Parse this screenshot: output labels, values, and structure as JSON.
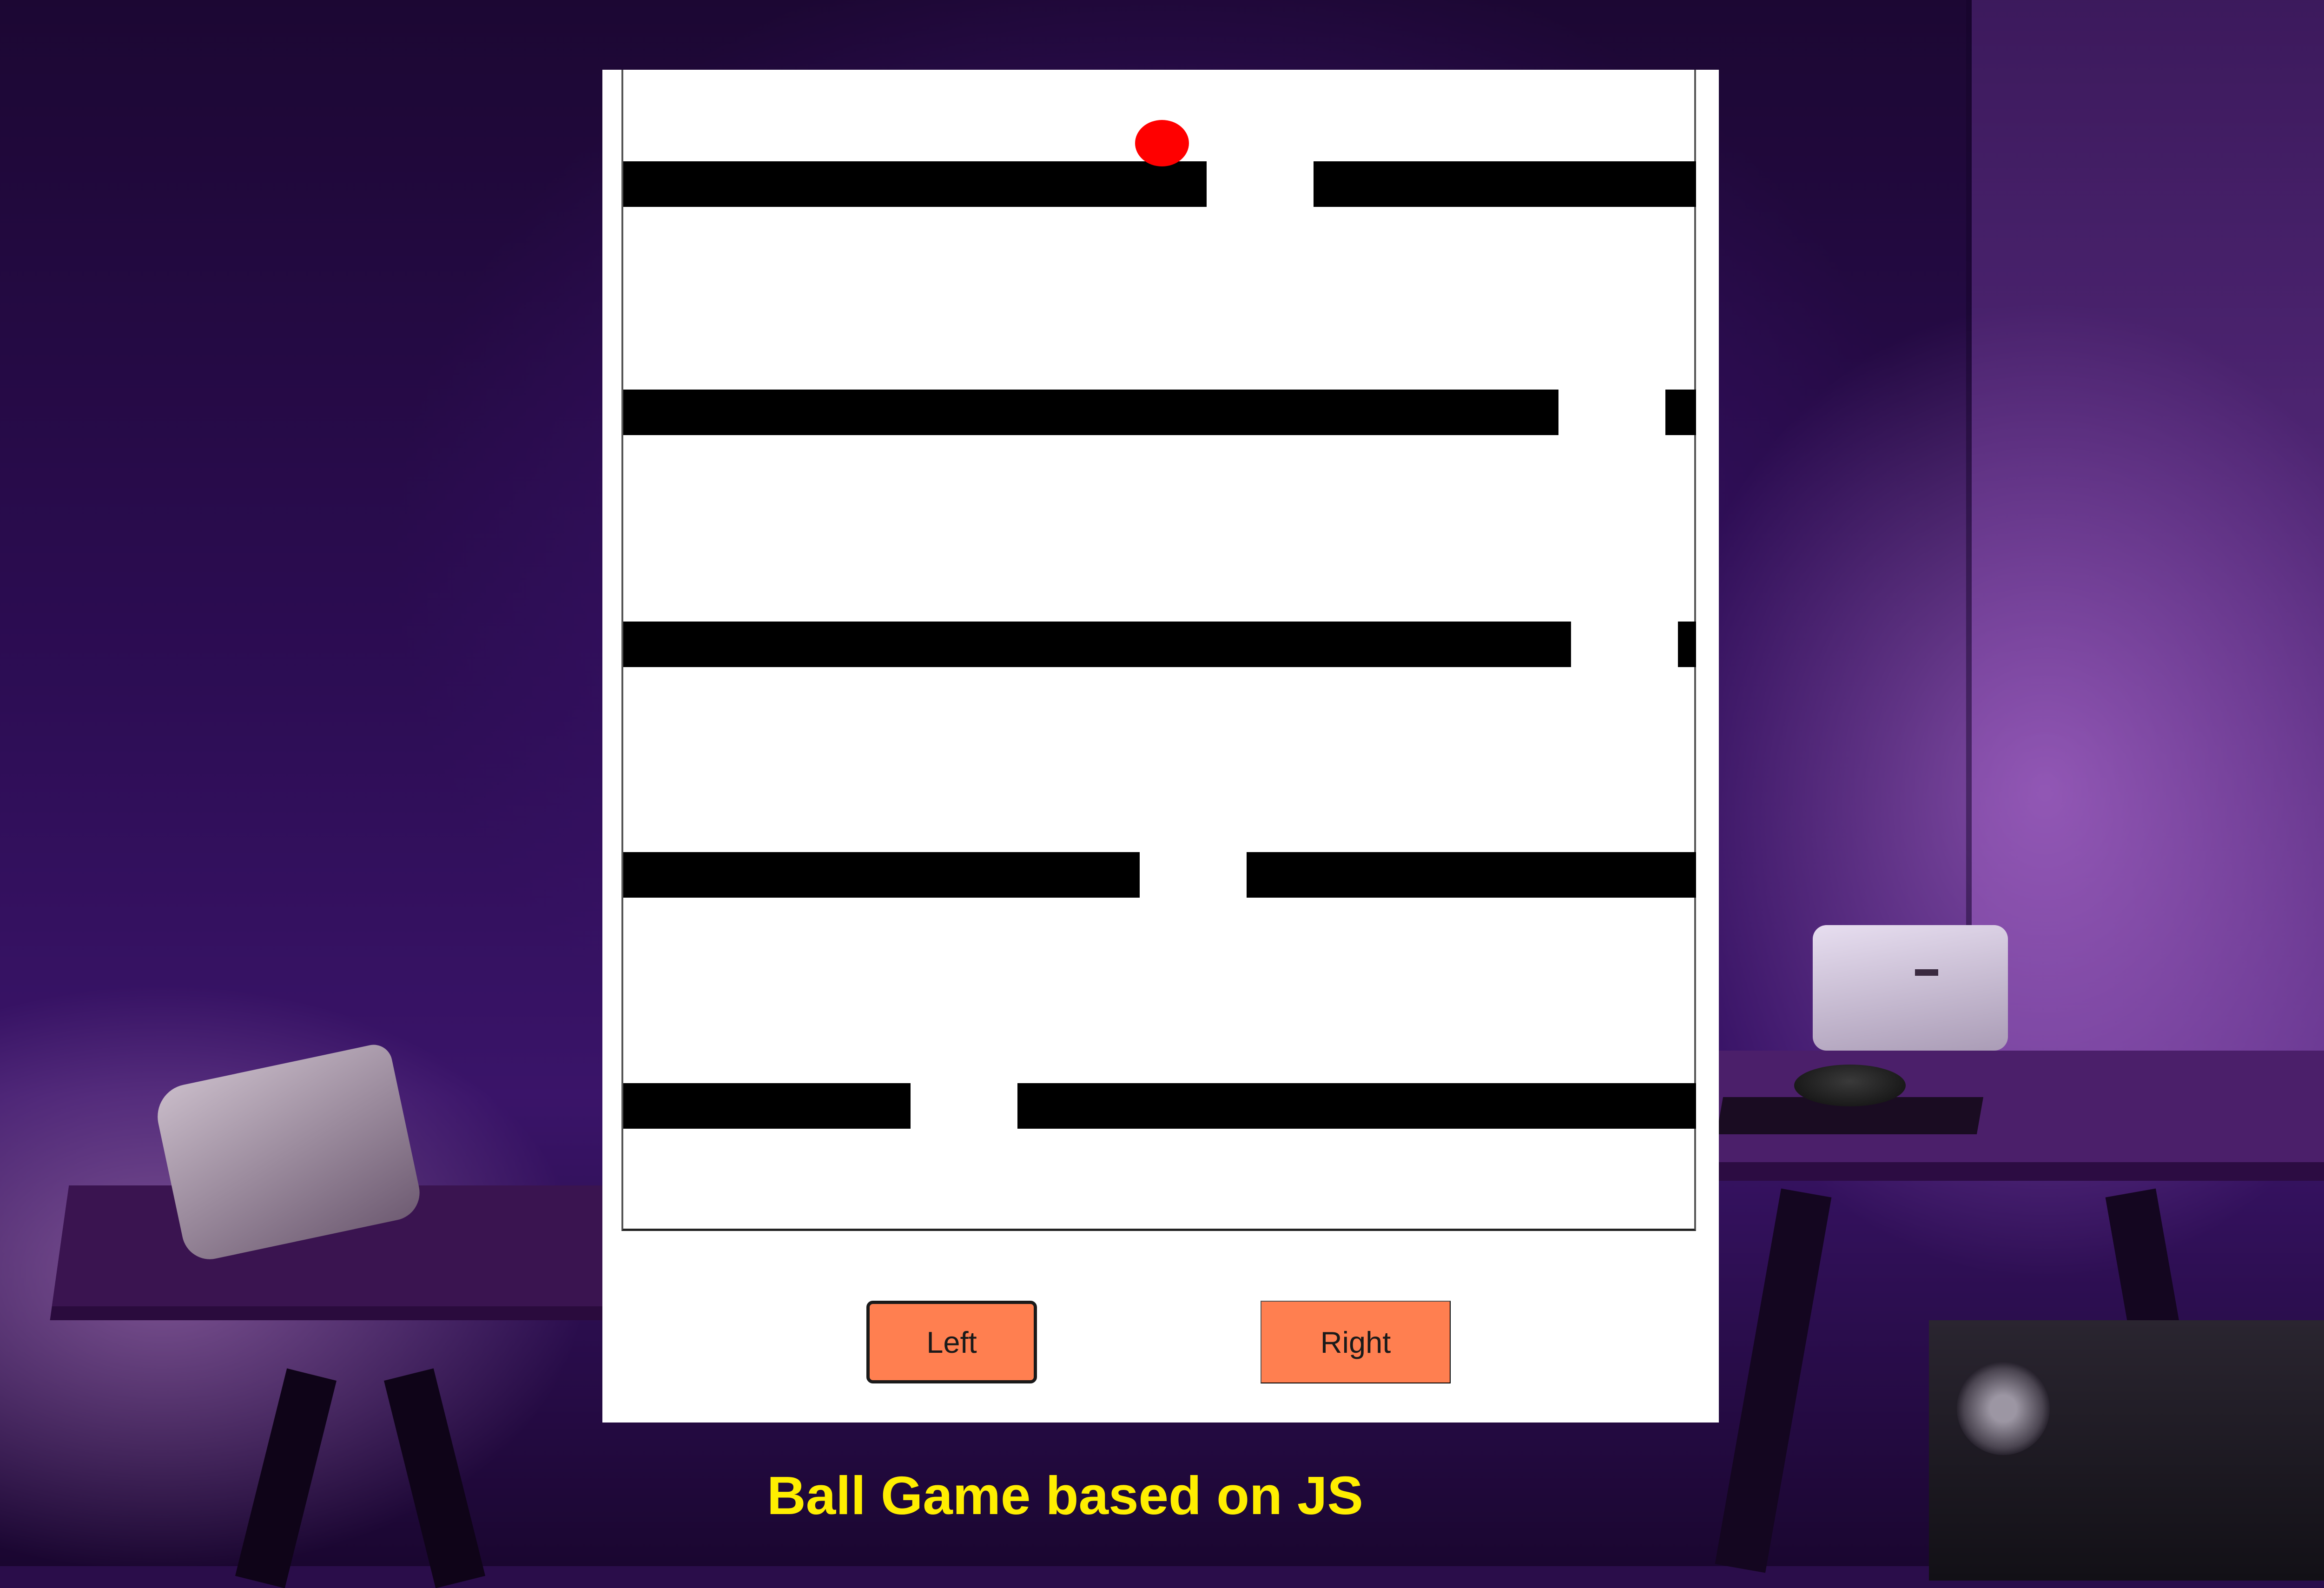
{
  "game": {
    "controls": {
      "left_label": "Left",
      "right_label": "Right"
    },
    "caption": "Ball Game based on JS",
    "ball_color": "#ff0000",
    "button_color": "#ff7f50",
    "caption_color": "#ffee00",
    "bar_color": "#000000"
  }
}
